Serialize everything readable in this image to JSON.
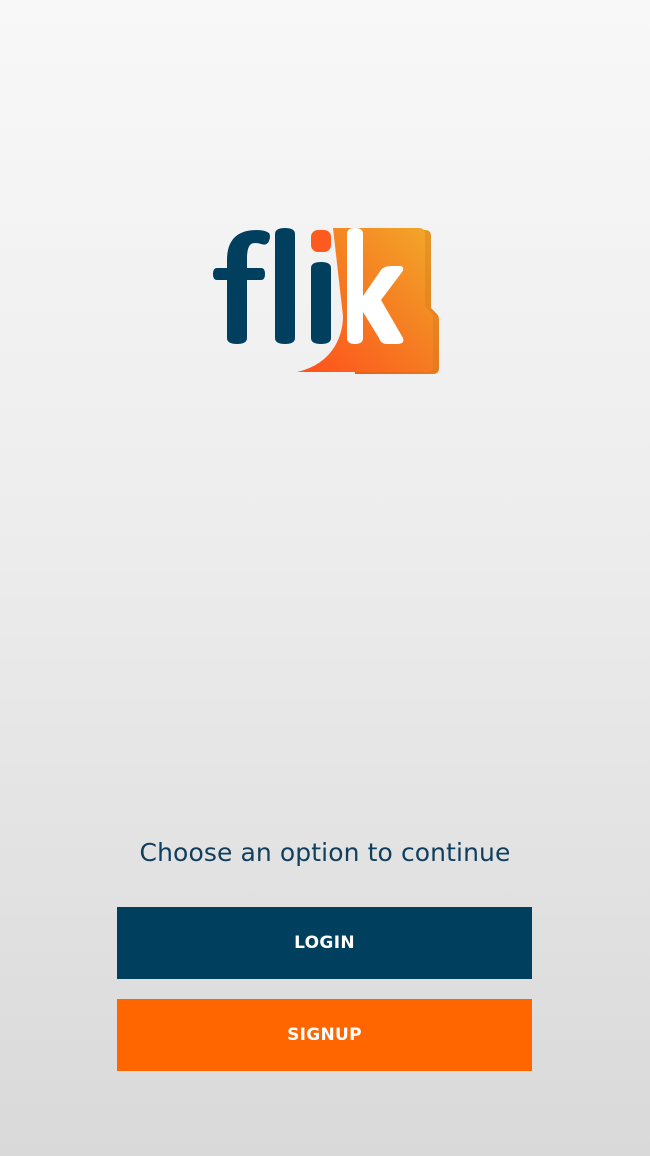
{
  "app": {
    "logo_text": "flik"
  },
  "welcome": {
    "prompt": "Choose an option to continue",
    "login_label": "LOGIN",
    "signup_label": "SIGNUP"
  },
  "colors": {
    "brand_navy": "#003f5e",
    "brand_orange": "#ff6600",
    "logo_gradient_start": "#ff5a1f",
    "logo_gradient_end": "#f2a52a"
  },
  "icons": {
    "logo": "flik-logo-icon"
  }
}
